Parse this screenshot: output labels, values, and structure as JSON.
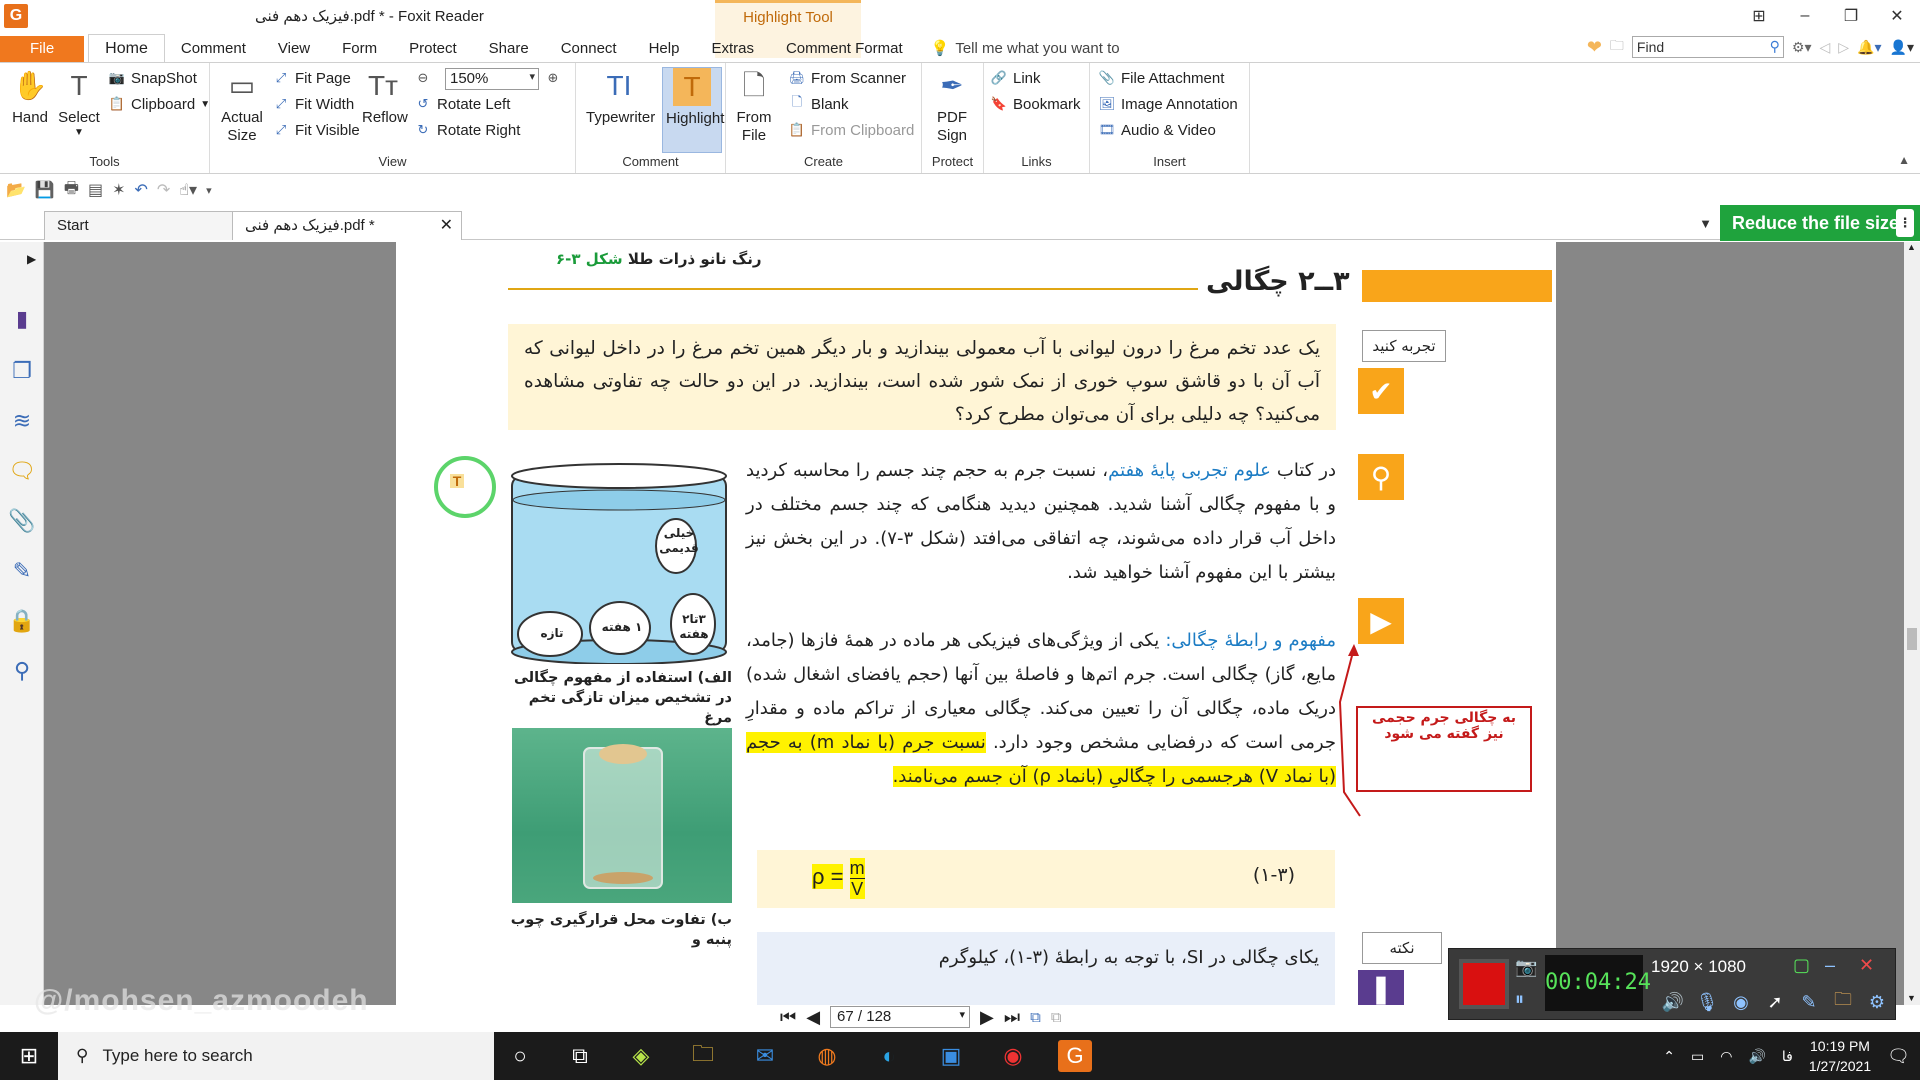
{
  "window": {
    "title": "فیزیک دهم فنی.pdf * - Foxit Reader",
    "contextual_group": "Highlight Tool"
  },
  "ribbon_tabs": [
    "File",
    "Home",
    "Comment",
    "View",
    "Form",
    "Protect",
    "Share",
    "Connect",
    "Help",
    "Extras",
    "Comment Format"
  ],
  "tell_me": "Tell me what you want to",
  "find": {
    "placeholder": "Find"
  },
  "ribbon": {
    "tools": {
      "label": "Tools",
      "hand": "Hand",
      "select": "Select",
      "snapshot": "SnapShot",
      "clipboard": "Clipboard"
    },
    "view": {
      "label": "View",
      "actual_size_1": "Actual",
      "actual_size_2": "Size",
      "fit_page": "Fit Page",
      "fit_width": "Fit Width",
      "fit_visible": "Fit Visible",
      "reflow": "Reflow",
      "zoom": "150%",
      "rotate_left": "Rotate Left",
      "rotate_right": "Rotate Right"
    },
    "comment": {
      "label": "Comment",
      "typewriter": "Typewriter",
      "highlight": "Highlight"
    },
    "create": {
      "label": "Create",
      "from_file_1": "From",
      "from_file_2": "File",
      "from_scanner": "From Scanner",
      "blank": "Blank",
      "from_clipboard": "From Clipboard"
    },
    "protect": {
      "label": "Protect",
      "pdf_sign_1": "PDF",
      "pdf_sign_2": "Sign"
    },
    "links": {
      "label": "Links",
      "link": "Link",
      "bookmark": "Bookmark"
    },
    "insert": {
      "label": "Insert",
      "file_attachment": "File Attachment",
      "image_annotation": "Image Annotation",
      "audio_video": "Audio & Video"
    }
  },
  "doc_tabs": {
    "start": "Start",
    "current": "فیزیک دهم فنی.pdf *"
  },
  "reduce_button": "Reduce the file size",
  "page": {
    "fig_caption_top_num": "شکل ۳-۶",
    "fig_caption_top_text": "رنگ نانو ذرات طلا",
    "section_title": "۳ــ۲ چگالی",
    "label_try": "تجربه کنید",
    "try_text": "یک عدد تخم مرغ را درون لیوانی با آب معمولی بیندازید و بار دیگر همین تخم مرغ را در داخل لیوانی که آب آن با دو قاشق سوپ خوری از نمک شور شده است، بیندازید. در این دو حالت چه تفاوتی مشاهده می‌کنید؟ چه دلیلی برای آن می‌توان مطرح کرد؟",
    "body1_a": "در کتاب ",
    "body1_link": "علوم تجربی پایهٔ هفتم",
    "body1_b": "، نسبت جرم به حجم چند جسم را محاسبه کردید و با مفهوم چگالی آشنا شدید. همچنین دیدید هنگامی که چند جسم مختلف در داخل آب قرار داده می‌شوند، چه اتفاقی می‌افتد (شکل ۳-۷). در این بخش نیز بیشتر با این مفهوم آشنا خواهید شد.",
    "body2_heading": "مفهوم و رابطهٔ چگالی:",
    "body2_a": " یکی از ویژگی‌های فیزیکی هر ماده در همهٔ فازها (جامد، مایع، گاز) چگالی است. جرم اتم‌ها و فاصلهٔ بین آنها (حجم یافضای اشغال شده) دریک ماده، چگالی آن را تعیین می‌کند. چگالی معیاری از تراکم ماده و مقدارِ جرمی است که درفضایی مشخص وجود دارد. ",
    "body2_hl": "نسبت جرم (با نماد m) به حجم (با نماد V) هرجسمی را چگالیِ (بانماد ρ) آن جسم می‌نامند.",
    "formula_lhs": "ρ =",
    "formula_num": "m",
    "formula_den": "V",
    "eq_num": "(۱-۳)",
    "label_note": "نکته",
    "si_text": "یکای چگالی در SI، با توجه به رابطهٔ (۳-۱)، کیلوگرم",
    "annotation": "به چگالی جرم حجمی نیز گفته می شود",
    "beaker_labels": [
      "خیلی قدیمی",
      "تازه",
      "۱ هفته",
      "۳تا۲ هفته"
    ],
    "caption_a": "الف) استفاده از مفهوم چگالی در تشخیص میزان تازگی تخم مرغ",
    "caption_b": "ب) تفاوت محل قرارگیری چوب پنبه و"
  },
  "nav": {
    "page_display": "67 / 128"
  },
  "watermark": "@/mohsen_azmoodeh",
  "recorder": {
    "time": "00:04:24",
    "resolution": "1920 × 1080"
  },
  "taskbar": {
    "search": "Type here to search",
    "time": "10:19 PM",
    "date": "1/27/2021",
    "lang": "فا"
  }
}
